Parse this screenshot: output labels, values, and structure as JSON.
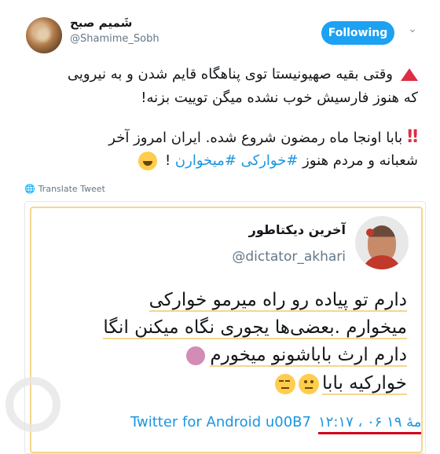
{
  "tweet": {
    "author_name": "شَمیم صبح",
    "author_handle": "@Shamime_Sobh",
    "follow_label": "Following",
    "line1": "وقتی بقیه صهیونیستا توی پناهگاه قایم شدن و به نیرویی",
    "line2": "که هنوز فارسیش خوب نشده میگن توییت بزنه!",
    "line3": "بابا اونجا ماه رمضون شروع شده. ایران امروز آخر",
    "line4_text": "شعبانه و مردم هنوز",
    "line4_hashtags": "#خوارکی #میخوارن",
    "line4_end": " ! ",
    "translate_label": "Translate Tweet",
    "icons": [
      "warning-triangle-icon",
      "double-exclamation-icon",
      "laughing-tears-icon",
      "globe-icon",
      "chevron-down-icon"
    ]
  },
  "quoted": {
    "name": "آخرین دیکتاطور",
    "handle": "@dictator_akhari",
    "line1": "دارم تو پیاده رو راه میرمو خوارکی",
    "line2": "میخوارم .بعضی‌ها یجوری نگاه میکنن انگا",
    "line3": "دارم ارث باباشونو میخورم",
    "line4": "خوارکیه بابا",
    "source": "Twitter for Android u00B7",
    "timestamp": "۱۲:۱۷ ، ۰۶ مهٔ ۱۹",
    "colors": {
      "highlight": "#f5d68f",
      "underline_red": "#d0021b",
      "link": "#1b95e0"
    }
  }
}
